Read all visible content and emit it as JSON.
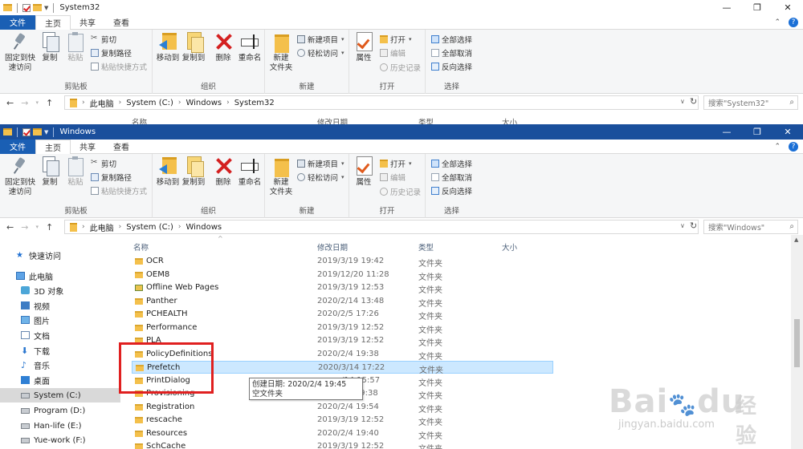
{
  "window_top": {
    "title": "System32",
    "tabs": [
      "文件",
      "主页",
      "共享",
      "查看"
    ],
    "ribbon": {
      "clipboard": {
        "label": "剪贴板",
        "pin": "固定到快\n速访问",
        "copy": "复制",
        "paste": "粘贴",
        "cut": "剪切",
        "copy_path": "复制路径",
        "paste_shortcut": "粘贴快捷方式"
      },
      "organize": {
        "label": "组织",
        "move_to": "移动到",
        "copy_to": "复制到",
        "delete": "删除",
        "rename": "重命名"
      },
      "new": {
        "label": "新建",
        "new_folder": "新建\n文件夹",
        "new_item": "新建项目",
        "easy_access": "轻松访问"
      },
      "open": {
        "label": "打开",
        "properties": "属性",
        "open": "打开",
        "edit": "编辑",
        "history": "历史记录"
      },
      "select": {
        "label": "选择",
        "select_all": "全部选择",
        "select_none": "全部取消",
        "invert": "反向选择"
      }
    },
    "breadcrumb": [
      "此电脑",
      "System (C:)",
      "Windows",
      "System32"
    ],
    "search_placeholder": "搜索\"System32\"",
    "column_headers": [
      "名称",
      "修改日期",
      "类型",
      "大小"
    ]
  },
  "window_main": {
    "title": "Windows",
    "tabs": [
      "文件",
      "主页",
      "共享",
      "查看"
    ],
    "ribbon": {
      "clipboard": {
        "label": "剪贴板",
        "pin": "固定到快\n速访问",
        "copy": "复制",
        "paste": "粘贴",
        "cut": "剪切",
        "copy_path": "复制路径",
        "paste_shortcut": "粘贴快捷方式"
      },
      "organize": {
        "label": "组织",
        "move_to": "移动到",
        "copy_to": "复制到",
        "delete": "删除",
        "rename": "重命名"
      },
      "new": {
        "label": "新建",
        "new_folder": "新建\n文件夹",
        "new_item": "新建项目",
        "easy_access": "轻松访问"
      },
      "open": {
        "label": "打开",
        "properties": "属性",
        "open": "打开",
        "edit": "编辑",
        "history": "历史记录"
      },
      "select": {
        "label": "选择",
        "select_all": "全部选择",
        "select_none": "全部取消",
        "invert": "反向选择"
      }
    },
    "breadcrumb": [
      "此电脑",
      "System (C:)",
      "Windows"
    ],
    "search_placeholder": "搜索\"Windows\"",
    "column_headers": [
      "名称",
      "修改日期",
      "类型",
      "大小"
    ],
    "nav_items": [
      {
        "label": "快速访问",
        "icon": "star-icon"
      },
      {
        "label": "此电脑",
        "icon": "computer-icon"
      },
      {
        "label": "3D 对象",
        "icon": "3d-objects-icon"
      },
      {
        "label": "视频",
        "icon": "video-icon"
      },
      {
        "label": "图片",
        "icon": "pictures-icon"
      },
      {
        "label": "文档",
        "icon": "documents-icon"
      },
      {
        "label": "下载",
        "icon": "download-icon"
      },
      {
        "label": "音乐",
        "icon": "music-icon"
      },
      {
        "label": "桌面",
        "icon": "desktop-icon"
      },
      {
        "label": "System (C:)",
        "icon": "drive-icon"
      },
      {
        "label": "Program (D:)",
        "icon": "drive-icon"
      },
      {
        "label": "Han-life (E:)",
        "icon": "drive-icon"
      },
      {
        "label": "Yue-work (F:)",
        "icon": "drive-icon"
      }
    ],
    "files": [
      {
        "name": "OCR",
        "date": "2019/3/19 19:42",
        "type": "文件夹"
      },
      {
        "name": "OEM8",
        "date": "2019/12/20 11:28",
        "type": "文件夹"
      },
      {
        "name": "Offline Web Pages",
        "date": "2019/3/19 12:53",
        "type": "文件夹"
      },
      {
        "name": "Panther",
        "date": "2020/2/14 13:48",
        "type": "文件夹"
      },
      {
        "name": "PCHEALTH",
        "date": "2020/2/5 17:26",
        "type": "文件夹"
      },
      {
        "name": "Performance",
        "date": "2019/3/19 12:52",
        "type": "文件夹"
      },
      {
        "name": "PLA",
        "date": "2019/3/19 12:52",
        "type": "文件夹"
      },
      {
        "name": "PolicyDefinitions",
        "date": "2020/2/4 19:38",
        "type": "文件夹"
      },
      {
        "name": "Prefetch",
        "date": "2020/3/14 17:22",
        "type": "文件夹"
      },
      {
        "name": "PrintDialog",
        "date": "/14 15:57",
        "type": "文件夹"
      },
      {
        "name": "Provisioning",
        "date": "/4 19:38",
        "type": "文件夹"
      },
      {
        "name": "Registration",
        "date": "2020/2/4 19:54",
        "type": "文件夹"
      },
      {
        "name": "rescache",
        "date": "2019/3/19 12:52",
        "type": "文件夹"
      },
      {
        "name": "Resources",
        "date": "2020/2/4 19:40",
        "type": "文件夹"
      },
      {
        "name": "SchCache",
        "date": "2019/3/19 12:52",
        "type": "文件夹"
      }
    ],
    "selected_file_index": 8,
    "tooltip": {
      "line1": "创建日期: 2020/2/4 19:45",
      "line2": "空文件夹"
    }
  },
  "watermark": {
    "logo": "Bai",
    "logo2": "du",
    "cn": "经验",
    "url": "jingyan.baidu.com"
  },
  "colors": {
    "file_tab": "#1a5fb4",
    "title_active": "#1a4f9c",
    "highlight": "#e02020",
    "selection": "#cce8ff"
  }
}
